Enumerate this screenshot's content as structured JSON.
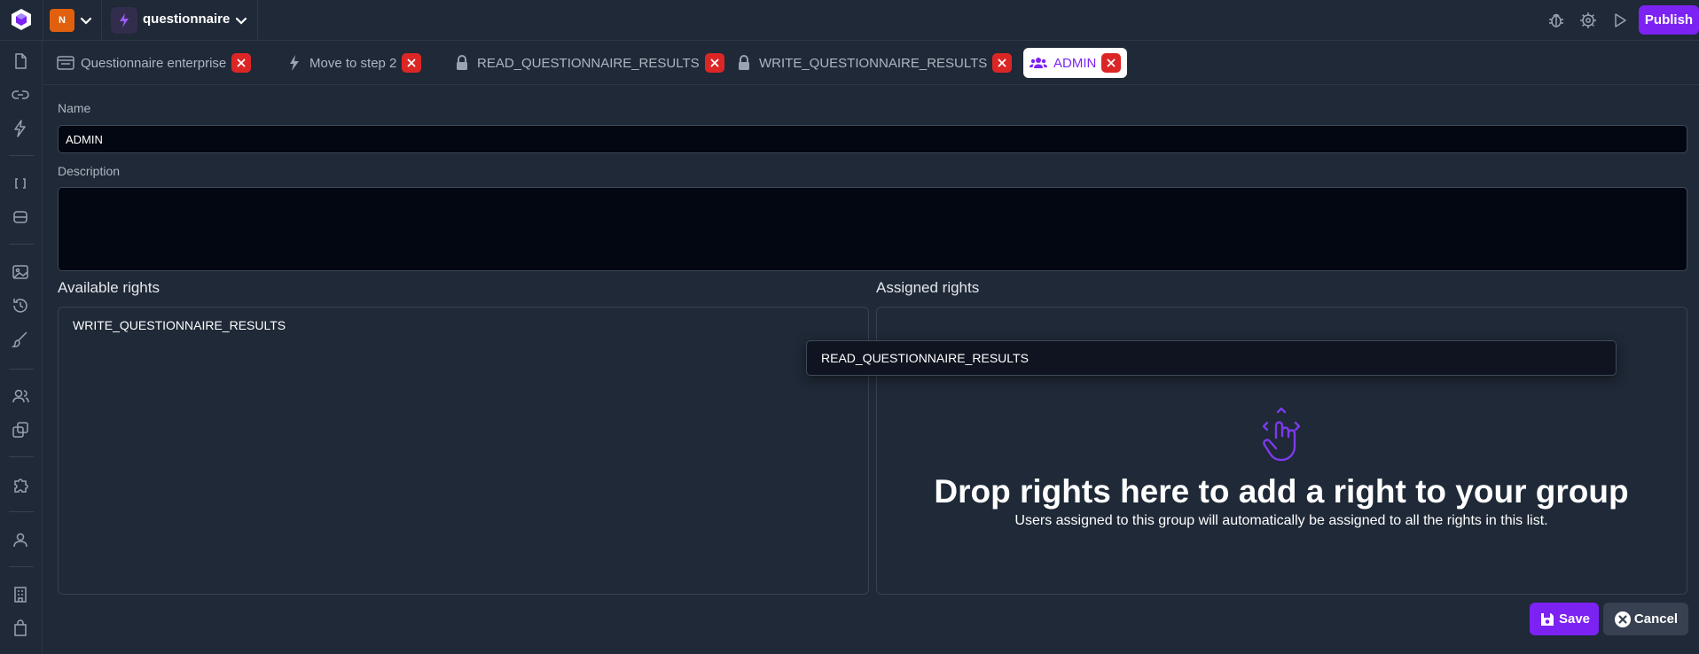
{
  "header": {
    "org_initial": "N",
    "app_name": "questionnaire",
    "publish_label": "Publish"
  },
  "tabs": [
    {
      "label": "Questionnaire enterprise",
      "icon": "page-layout-icon"
    },
    {
      "label": "Move to step 2",
      "icon": "lightning-icon"
    },
    {
      "label": "READ_QUESTIONNAIRE_RESULTS",
      "icon": "lock-icon"
    },
    {
      "label": "WRITE_QUESTIONNAIRE_RESULTS",
      "icon": "lock-icon"
    },
    {
      "label": "ADMIN",
      "icon": "users-group-icon",
      "active": true
    }
  ],
  "form": {
    "name_label": "Name",
    "name_value": "ADMIN",
    "description_label": "Description",
    "description_value": ""
  },
  "available": {
    "title": "Available rights",
    "items": [
      "WRITE_QUESTIONNAIRE_RESULTS"
    ]
  },
  "assigned": {
    "title": "Assigned rights",
    "dragging_item": "READ_QUESTIONNAIRE_RESULTS",
    "drop_title": "Drop rights here to add a right to your group",
    "drop_subtitle": "Users assigned to this group will automatically be assigned to all the rights in this list."
  },
  "actions": {
    "save_label": "Save",
    "cancel_label": "Cancel"
  },
  "colors": {
    "background": "#1f2937",
    "accent": "#7c22f2",
    "danger": "#dc2626",
    "org_avatar": "#e0600e"
  }
}
